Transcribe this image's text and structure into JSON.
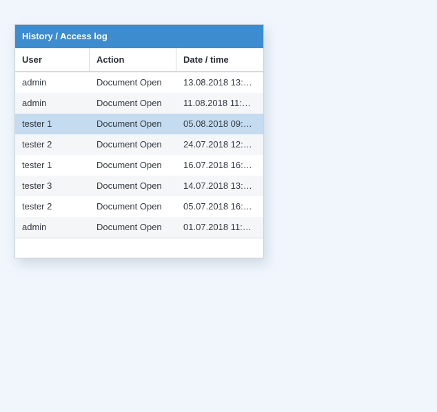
{
  "panel": {
    "title": "History / Access log"
  },
  "columns": {
    "user": "User",
    "action": "Action",
    "date": "Date / time"
  },
  "rows": [
    {
      "user": "admin",
      "action": "Document Open",
      "date": "13.08.2018 13:…"
    },
    {
      "user": "admin",
      "action": "Document Open",
      "date": "11.08.2018 11:…"
    },
    {
      "user": "tester 1",
      "action": "Document Open",
      "date": "05.08.2018 09:…"
    },
    {
      "user": "tester 2",
      "action": "Document Open",
      "date": "24.07.2018 12:…"
    },
    {
      "user": "tester 1",
      "action": "Document Open",
      "date": "16.07.2018 16:…"
    },
    {
      "user": "tester 3",
      "action": "Document Open",
      "date": "14.07.2018 13:…"
    },
    {
      "user": "tester 2",
      "action": "Document Open",
      "date": "05.07.2018 16:…"
    },
    {
      "user": "admin",
      "action": "Document Open",
      "date": "01.07.2018 11:…"
    }
  ],
  "selected_row": 2,
  "colors": {
    "header_bg": "#3d8ccf",
    "selected_bg": "#c5dbef",
    "page_bg": "#f1f6fd"
  }
}
